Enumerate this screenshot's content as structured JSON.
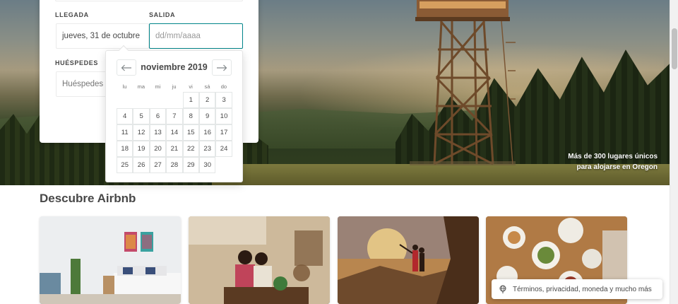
{
  "booking": {
    "checkin_label": "LLEGADA",
    "checkout_label": "SALIDA",
    "checkin_value": "jueves, 31 de octubre",
    "checkout_placeholder": "dd/mm/aaaa",
    "guests_label": "HUÉSPEDES",
    "guests_placeholder": "Huéspedes"
  },
  "calendar": {
    "month_title": "noviembre 2019",
    "weekdays": [
      "lu",
      "ma",
      "mi",
      "ju",
      "vi",
      "sá",
      "do"
    ],
    "weeks": [
      [
        "",
        "",
        "",
        "",
        "1",
        "2",
        "3"
      ],
      [
        "4",
        "5",
        "6",
        "7",
        "8",
        "9",
        "10"
      ],
      [
        "11",
        "12",
        "13",
        "14",
        "15",
        "16",
        "17"
      ],
      [
        "18",
        "19",
        "20",
        "21",
        "22",
        "23",
        "24"
      ],
      [
        "25",
        "26",
        "27",
        "28",
        "29",
        "30",
        ""
      ]
    ],
    "prev_icon": "arrow-left-icon",
    "next_icon": "arrow-right-icon"
  },
  "hero": {
    "caption_line1": "Más de 300 lugares únicos",
    "caption_line2": "para alojarse en Oregon"
  },
  "discover": {
    "title": "Descubre Airbnb"
  },
  "footer": {
    "label": "Términos, privacidad, moneda y mucho más",
    "icon": "globe-icon"
  },
  "colors": {
    "accent": "#008489",
    "text": "#484848"
  }
}
